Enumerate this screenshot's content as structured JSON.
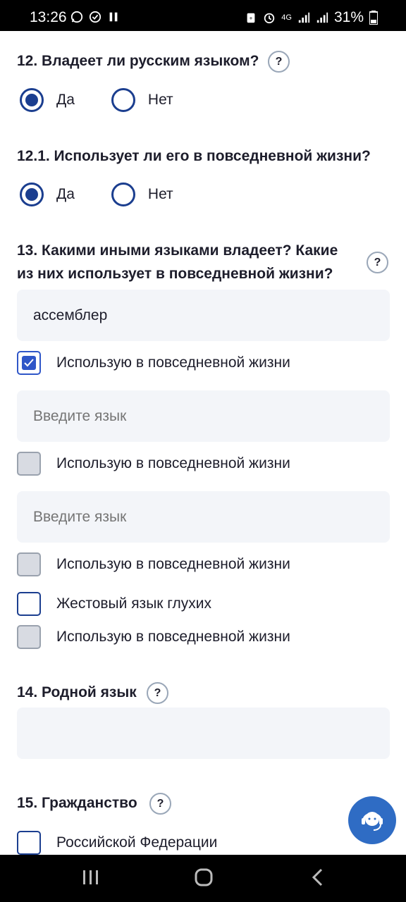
{
  "status_bar": {
    "time": "13:26",
    "left_icons": [
      "whatsapp-icon",
      "check-circle-icon",
      "pause-icon"
    ],
    "network": "4G",
    "battery": "31%"
  },
  "questions": {
    "q12": {
      "title": "12. Владеет ли русским языком?",
      "help": "?",
      "options": [
        "Да",
        "Нет"
      ],
      "selected": "Да"
    },
    "q12_1": {
      "title": "12.1. Использует ли его в повседневной жизни?",
      "options": [
        "Да",
        "Нет"
      ],
      "selected": "Да"
    },
    "q13": {
      "title_line1": "13. Какими иными языками владеет? Какие",
      "title_line2": "из них использует в повседневной жизни?",
      "help": "?",
      "languages": [
        {
          "value": "ассемблер",
          "placeholder": "",
          "daily_label": "Использую в повседневной жизни",
          "daily_checked": true
        },
        {
          "value": "",
          "placeholder": "Введите язык",
          "daily_label": "Использую в повседневной жизни",
          "daily_checked": false
        },
        {
          "value": "",
          "placeholder": "Введите язык",
          "daily_label": "Использую в повседневной жизни",
          "daily_checked": false
        }
      ],
      "sign_language_label": "Жестовый язык глухих",
      "sign_daily_label": "Использую в повседневной жизни"
    },
    "q14": {
      "title": "14. Родной язык",
      "help": "?",
      "value": ""
    },
    "q15": {
      "title": "15. Гражданство",
      "help": "?",
      "option1": "Российской Федерации"
    }
  },
  "colors": {
    "accent": "#1b3e8f",
    "check_accent": "#2f56c8",
    "input_bg": "#f3f5f9",
    "fab": "#2f6cc4"
  }
}
